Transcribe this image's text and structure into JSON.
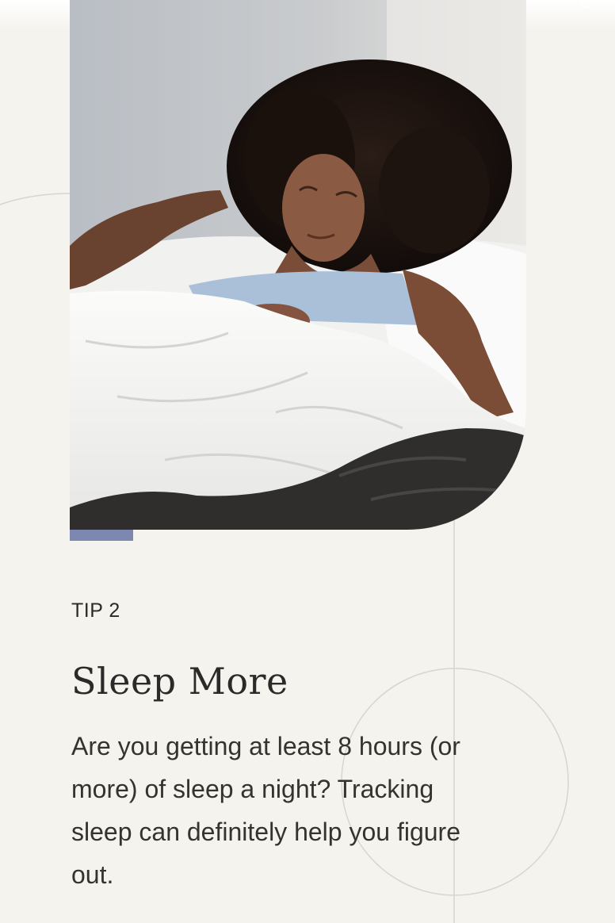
{
  "tip": {
    "label": "TIP 2",
    "title": "Sleep More",
    "body": "Are you getting at least 8 hours (or more) of sleep a night? Tracking sleep can definitely help you figure out."
  },
  "colors": {
    "background": "#f4f3ee",
    "accent": "#7e87b0",
    "text": "#2b2a28"
  },
  "image": {
    "subject": "woman-sleeping-in-bed"
  }
}
